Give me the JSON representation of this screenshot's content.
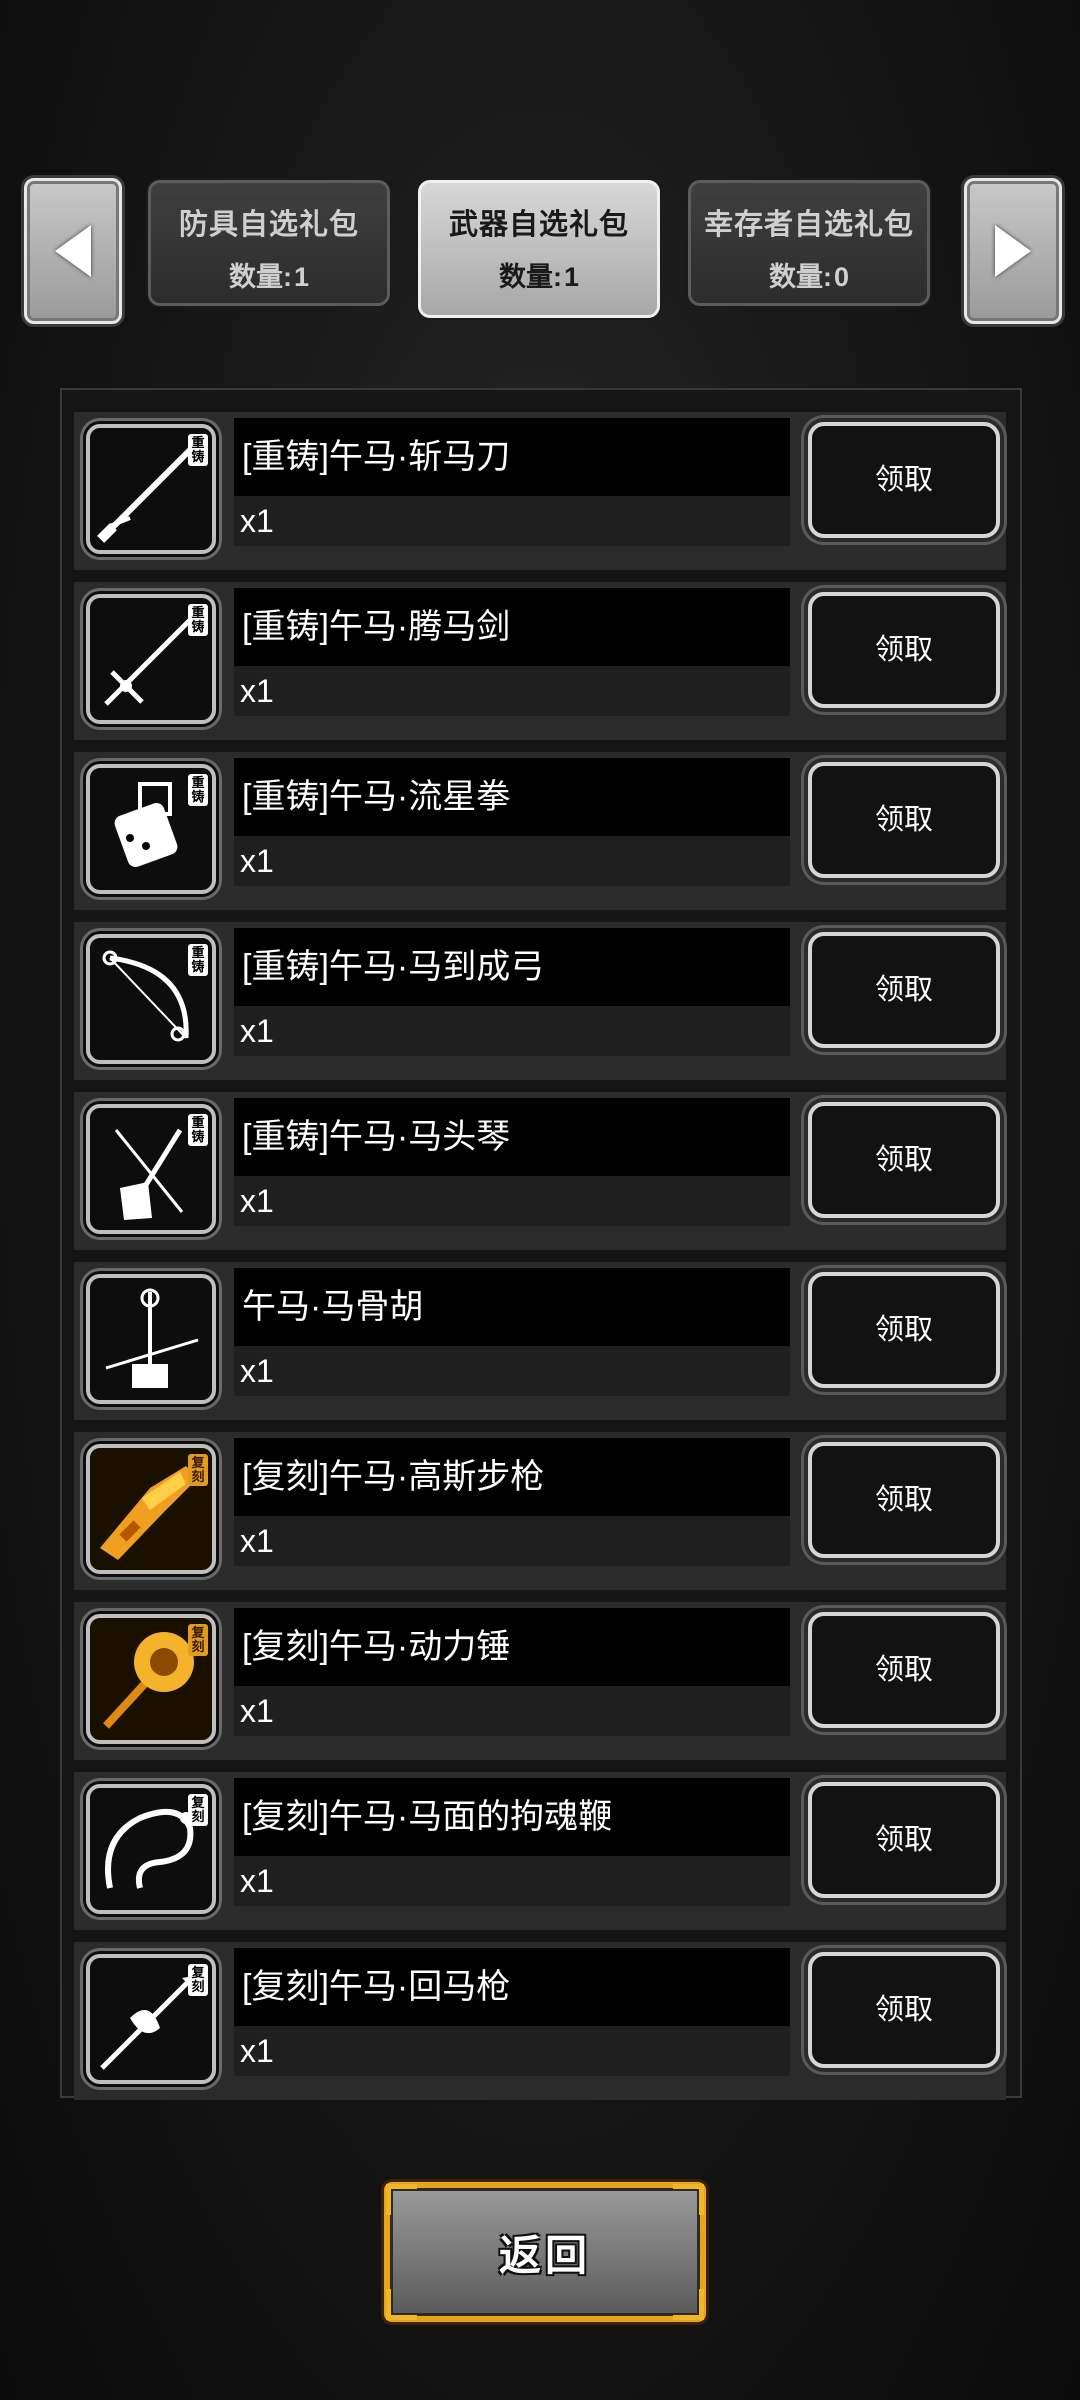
{
  "tabs": [
    {
      "title": "防具自选礼包",
      "count_label": "数量:",
      "count": "1",
      "active": false
    },
    {
      "title": "武器自选礼包",
      "count_label": "数量:",
      "count": "1",
      "active": true
    },
    {
      "title": "幸存者自选礼包",
      "count_label": "数量:",
      "count": "0",
      "active": false
    }
  ],
  "nav": {
    "prev_icon": "triangle-left",
    "next_icon": "triangle-right"
  },
  "claim_label": "领取",
  "items": [
    {
      "name": "[重铸]午马·斩马刀",
      "qty": "x1",
      "tag": "重铸",
      "icon": "blade",
      "gold": false
    },
    {
      "name": "[重铸]午马·腾马剑",
      "qty": "x1",
      "tag": "重铸",
      "icon": "sword",
      "gold": false
    },
    {
      "name": "[重铸]午马·流星拳",
      "qty": "x1",
      "tag": "重铸",
      "icon": "gauntlet",
      "gold": false
    },
    {
      "name": "[重铸]午马·马到成弓",
      "qty": "x1",
      "tag": "重铸",
      "icon": "bow",
      "gold": false
    },
    {
      "name": "[重铸]午马·马头琴",
      "qty": "x1",
      "tag": "重铸",
      "icon": "fiddle",
      "gold": false
    },
    {
      "name": "午马·马骨胡",
      "qty": "x1",
      "tag": "",
      "icon": "erhu",
      "gold": false
    },
    {
      "name": "[复刻]午马·高斯步枪",
      "qty": "x1",
      "tag": "复刻",
      "icon": "rifle",
      "gold": true
    },
    {
      "name": "[复刻]午马·动力锤",
      "qty": "x1",
      "tag": "复刻",
      "icon": "hammer",
      "gold": true
    },
    {
      "name": "[复刻]午马·马面的拘魂鞭",
      "qty": "x1",
      "tag": "复刻",
      "icon": "whip",
      "gold": false
    },
    {
      "name": "[复刻]午马·回马枪",
      "qty": "x1",
      "tag": "复刻",
      "icon": "spear",
      "gold": false
    }
  ],
  "back_label": "返回"
}
